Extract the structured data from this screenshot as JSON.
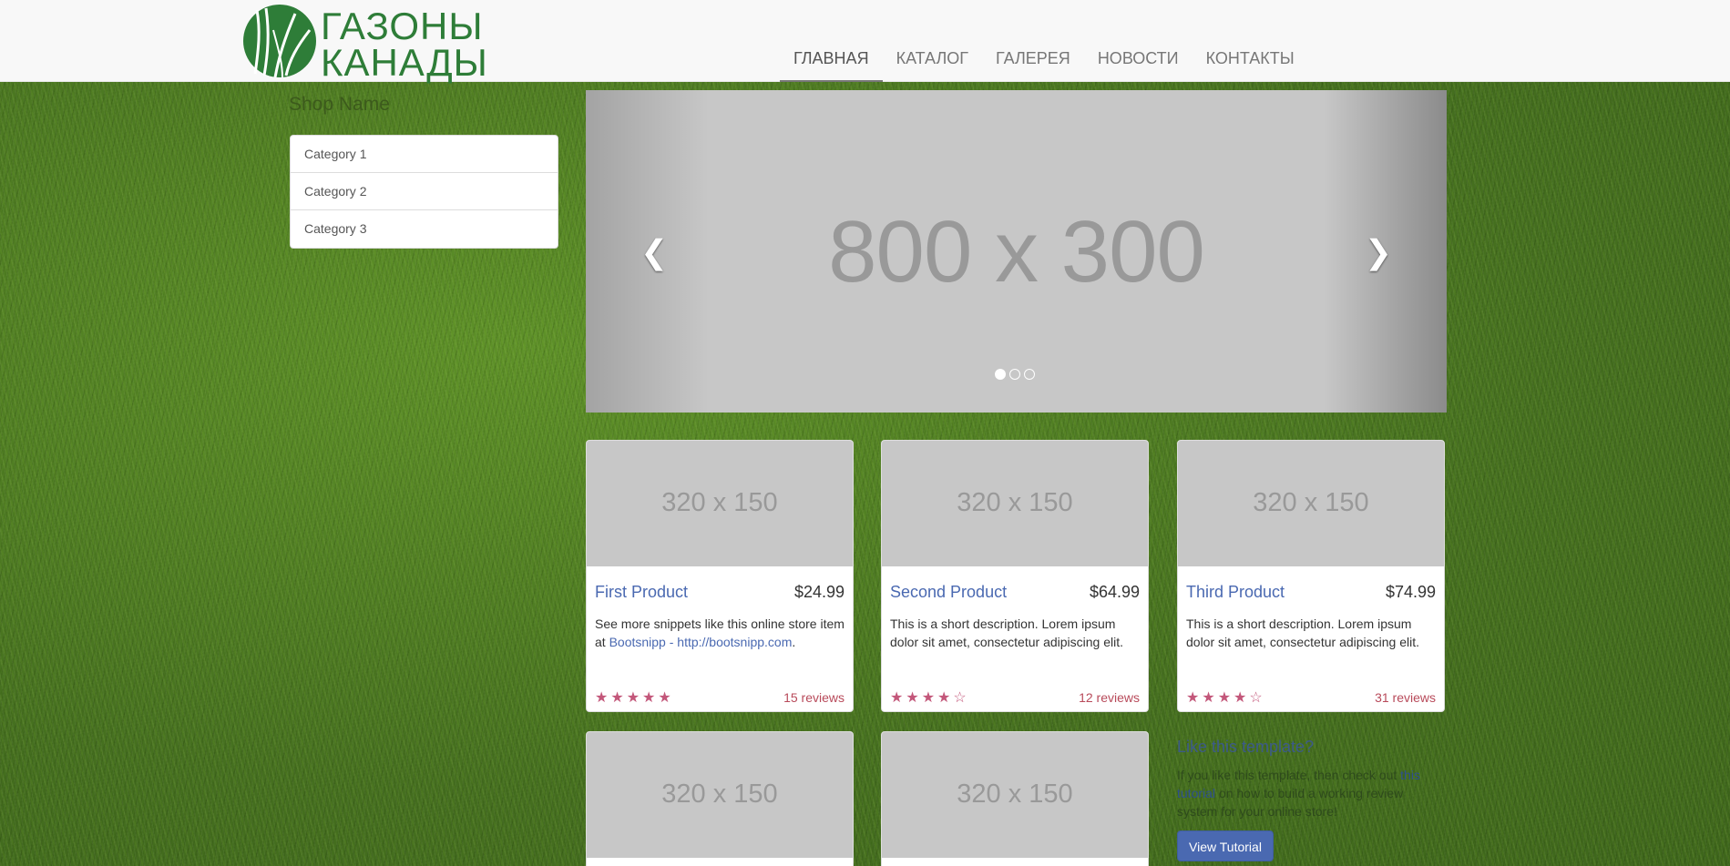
{
  "header": {
    "logo_text": "ГАЗОНЫ\nКАНАДЫ",
    "nav": [
      "ГЛАВНАЯ",
      "КАТАЛОГ",
      "ГАЛЕРЕЯ",
      "НОВОСТИ",
      "КОНТАКТЫ"
    ],
    "active_nav": "ГЛАВНАЯ"
  },
  "sidebar": {
    "shop_name": "Shop Name",
    "categories": [
      "Category 1",
      "Category 2",
      "Category 3"
    ]
  },
  "carousel": {
    "placeholder": "800 x 300",
    "prev_icon": "chevron-left-icon",
    "next_icon": "chevron-right-icon",
    "slide_count": 3,
    "active_slide": 1
  },
  "products": [
    {
      "name": "First Product",
      "price": "$24.99",
      "image": "320 x 150",
      "desc_prefix": "See more snippets like this online store item at ",
      "desc_link": "Bootsnipp - http://bootsnipp.com",
      "desc_suffix": ".",
      "stars": "★★★★★",
      "rating": 5,
      "reviews": "15 reviews"
    },
    {
      "name": "Second Product",
      "price": "$64.99",
      "image": "320 x 150",
      "desc": "This is a short description. Lorem ipsum dolor sit amet, consectetur adipiscing elit.",
      "stars": "★★★★☆",
      "rating": 4,
      "reviews": "12 reviews"
    },
    {
      "name": "Third Product",
      "price": "$74.99",
      "image": "320 x 150",
      "desc": "This is a short description. Lorem ipsum dolor sit amet, consectetur adipiscing elit.",
      "stars": "★★★★☆",
      "rating": 4,
      "reviews": "31 reviews"
    },
    {
      "image": "320 x 150"
    },
    {
      "image": "320 x 150"
    }
  ],
  "promo": {
    "title": "Like this template?",
    "text_prefix": "If you like this template, then check out ",
    "link": "this tutorial",
    "text_suffix": " on how to build a working review system for your online store!",
    "button": "View Tutorial"
  },
  "colors": {
    "link": "#4a69b1",
    "stars": "#c3577a",
    "logo_green": "#2e7d38"
  }
}
